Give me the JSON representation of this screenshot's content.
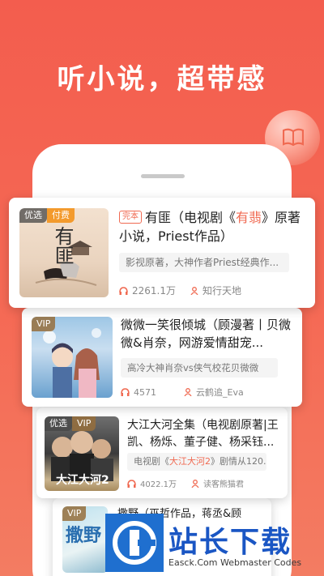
{
  "headline": "听小说，超带感",
  "colors": {
    "accent": "#f06a52",
    "bg_top": "#f35d4e",
    "tag_orange": "#f39a2c",
    "watermark_blue": "#1f6fcf"
  },
  "books": [
    {
      "badges": [
        "优选",
        "付费"
      ],
      "tag": "完本",
      "title_pre": "有匪（电视剧《",
      "title_hl": "有翡",
      "title_post": "》原著小说，Priest作品）",
      "desc": "影视原著，大神作者Priest经典作...",
      "listens": "2261.1万",
      "author": "知行天地"
    },
    {
      "badges": [
        "VIP"
      ],
      "title": "微微一笑很倾城（顾漫著丨贝微微&肖奈，网游爱情甜宠...",
      "desc": "高冷大神肖奈vs侠气校花贝微微",
      "listens": "4571",
      "author": "云鹤追_Eva"
    },
    {
      "badges": [
        "优选",
        "VIP"
      ],
      "title": "大江大河全集（电视剧原著|王凯、杨烁、董子健、杨采钰...",
      "desc_pre": "电视剧《",
      "desc_hl": "大江大河2",
      "desc_post": "》剧情从120...",
      "listens": "4022.1万",
      "author": "读客熊猫君"
    },
    {
      "badges": [
        "VIP"
      ],
      "title": "撒野（巫哲作品，蒋丞&顾"
    }
  ],
  "cover_text": {
    "b1": "有匪",
    "b3": "大江大河2",
    "b4": "撒野"
  },
  "watermark": {
    "main": "站长下载",
    "sub": "Easck.Com Webmaster Codes"
  }
}
